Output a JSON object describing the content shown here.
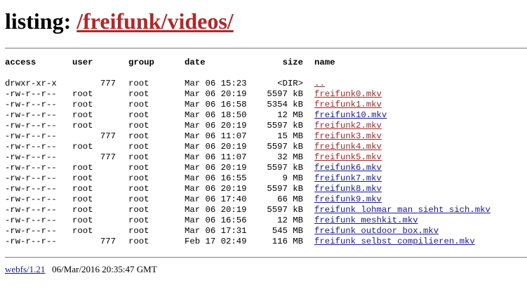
{
  "heading": {
    "prefix": "listing: ",
    "path": "/freifunk/videos/"
  },
  "table": {
    "headers": {
      "access": "access",
      "user": "user",
      "group": "group",
      "date": "date",
      "size": "size",
      "name": "name"
    },
    "rows": [
      {
        "access": "drwxr-xr-x",
        "user": "777",
        "group": "root",
        "date": "Mar 06 15:23",
        "size": "<DIR>",
        "name": "..",
        "visited": true
      },
      {
        "access": "-rw-r--r--",
        "user": "root",
        "group": "root",
        "date": "Mar 06 20:19",
        "size": "5597 kB",
        "name": "freifunk0.mkv",
        "visited": true
      },
      {
        "access": "-rw-r--r--",
        "user": "root",
        "group": "root",
        "date": "Mar 06 16:58",
        "size": "5354 kB",
        "name": "freifunk1.mkv",
        "visited": true
      },
      {
        "access": "-rw-r--r--",
        "user": "root",
        "group": "root",
        "date": "Mar 06 18:50",
        "size": "12 MB",
        "name": "freifunk10.mkv",
        "visited": false
      },
      {
        "access": "-rw-r--r--",
        "user": "root",
        "group": "root",
        "date": "Mar 06 20:19",
        "size": "5597 kB",
        "name": "freifunk2.mkv",
        "visited": true
      },
      {
        "access": "-rw-r--r--",
        "user": "777",
        "group": "root",
        "date": "Mar 06 11:07",
        "size": "15 MB",
        "name": "freifunk3.mkv",
        "visited": true
      },
      {
        "access": "-rw-r--r--",
        "user": "root",
        "group": "root",
        "date": "Mar 06 20:19",
        "size": "5597 kB",
        "name": "freifunk4.mkv",
        "visited": true
      },
      {
        "access": "-rw-r--r--",
        "user": "777",
        "group": "root",
        "date": "Mar 06 11:07",
        "size": "32 MB",
        "name": "freifunk5.mkv",
        "visited": true
      },
      {
        "access": "-rw-r--r--",
        "user": "root",
        "group": "root",
        "date": "Mar 06 20:19",
        "size": "5597 kB",
        "name": "freifunk6.mkv",
        "visited": false
      },
      {
        "access": "-rw-r--r--",
        "user": "root",
        "group": "root",
        "date": "Mar 06 16:55",
        "size": "9 MB",
        "name": "freifunk7.mkv",
        "visited": false
      },
      {
        "access": "-rw-r--r--",
        "user": "root",
        "group": "root",
        "date": "Mar 06 20:19",
        "size": "5597 kB",
        "name": "freifunk8.mkv",
        "visited": false
      },
      {
        "access": "-rw-r--r--",
        "user": "root",
        "group": "root",
        "date": "Mar 06 17:40",
        "size": "66 MB",
        "name": "freifunk9.mkv",
        "visited": false
      },
      {
        "access": "-rw-r--r--",
        "user": "root",
        "group": "root",
        "date": "Mar 06 20:19",
        "size": "5597 kB",
        "name": "freifunk lohmar man sieht sich.mkv",
        "visited": false
      },
      {
        "access": "-rw-r--r--",
        "user": "root",
        "group": "root",
        "date": "Mar 06 16:56",
        "size": "12 MB",
        "name": "freifunk meshkit.mkv",
        "visited": false
      },
      {
        "access": "-rw-r--r--",
        "user": "root",
        "group": "root",
        "date": "Mar 06 17:31",
        "size": "545 MB",
        "name": "freifunk outdoor box.mkv",
        "visited": false
      },
      {
        "access": "-rw-r--r--",
        "user": "777",
        "group": "root",
        "date": "Feb 17 02:49",
        "size": "116 MB",
        "name": "freifunk selbst compilieren.mkv",
        "visited": false
      }
    ]
  },
  "footer": {
    "server_link": "webfs/1.21",
    "timestamp": "06/Mar/2016 20:35:47 GMT"
  },
  "colors": {
    "visited_link": "#a0282a",
    "unvisited_link": "#1a1a8c",
    "heading_link": "#b0282a"
  }
}
